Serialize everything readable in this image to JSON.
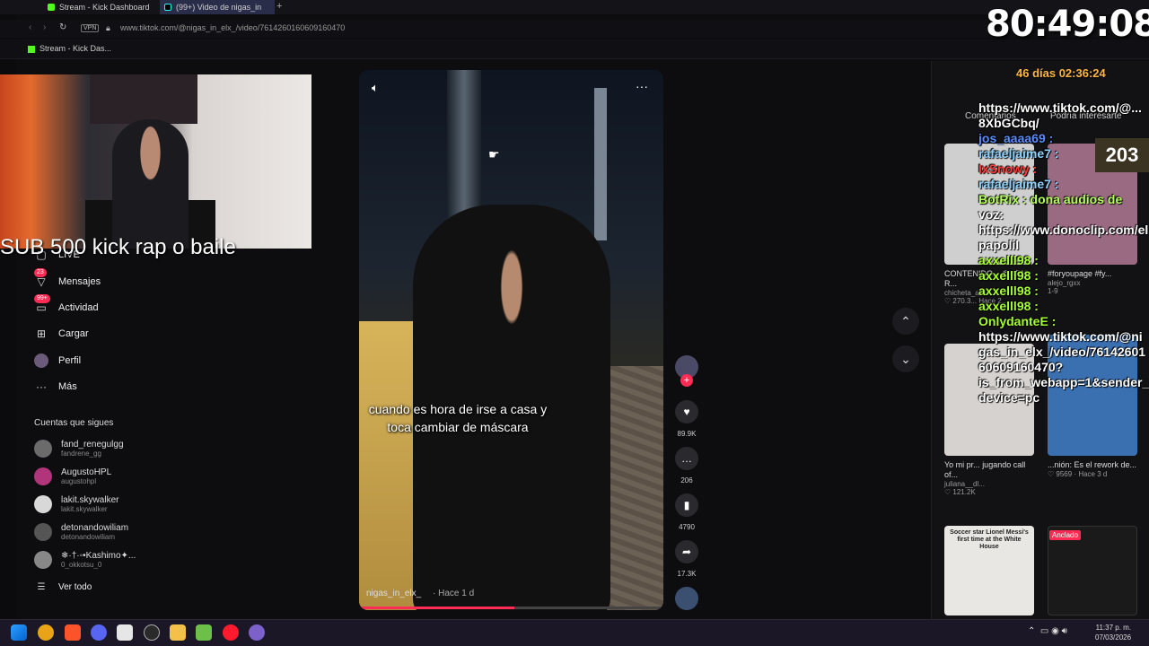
{
  "browser": {
    "tabs": [
      {
        "label": "Stream - Kick Dashboard"
      },
      {
        "label": "(99+) Video de nigas_in"
      }
    ],
    "url": "www.tiktok.com/@nigas_in_elx_/video/7614260160609160470",
    "vpn_label": "VPN",
    "bookmark": "Stream - Kick Das..."
  },
  "stream_overlay": {
    "text": "SUB 500 kick  rap o  baile",
    "timer": "80:49:08",
    "subtimer": "46 días 02:36:24",
    "viewers": "203"
  },
  "nav": {
    "items": [
      {
        "label": "LIVE",
        "icon": "live-icon"
      },
      {
        "label": "Mensajes",
        "icon": "message-icon",
        "badge": "23"
      },
      {
        "label": "Actividad",
        "icon": "inbox-icon",
        "badge": "99+"
      },
      {
        "label": "Cargar",
        "icon": "upload-icon"
      },
      {
        "label": "Perfil",
        "icon": "avatar"
      },
      {
        "label": "Más",
        "icon": "more-icon"
      }
    ],
    "following_title": "Cuentas que sigues",
    "following": [
      {
        "name": "fand_renegulgg",
        "handle": "fandrene_gg",
        "color": "#6b6b6b"
      },
      {
        "name": "AugustoHPL",
        "handle": "augustohpl",
        "color": "#b0357a"
      },
      {
        "name": "lakit.skywalker",
        "handle": "lakit.skywalker",
        "color": "#d8d8d8"
      },
      {
        "name": "detonandowiliam",
        "handle": "detonandowiliam",
        "color": "#555"
      },
      {
        "name": "❄·†·◦•Kashimo✦...",
        "handle": "0_okkotsu_0",
        "color": "#888"
      }
    ],
    "see_all": "Ver todo"
  },
  "video": {
    "caption": "cuando es hora de irse a casa y toca cambiar de máscara",
    "author": "nigas_in_elx_",
    "time": "· Hace 1 d",
    "progress_percent": 51,
    "likes": "89.9K",
    "comments": "206",
    "saves": "4790",
    "shares": "17.3K"
  },
  "right_panel": {
    "tabs": [
      "Comentarios",
      "Podría interesarte"
    ],
    "cards": [
      {
        "caption": "CONTENIDO... @KRIS R...",
        "author": "chicheta_a",
        "likes": "270.3...",
        "time": "Hace 2...",
        "color": "#cfcfcf"
      },
      {
        "caption": "#foryoupage #fy...",
        "author": "alejo_rgxx",
        "likes": "",
        "time": "1-9",
        "color": "#9a6a82"
      },
      {
        "caption": "Yo mi pr... jugando call of...",
        "author": "juliana__dl...",
        "likes": "121.2K",
        "time": "",
        "color": "#d6d2cf"
      },
      {
        "caption": "...nión: Es el rework de...",
        "author": "",
        "likes": "9569",
        "time": "Hace 3 d",
        "color": "#3a6fb0"
      },
      {
        "caption": "Soccer star Lionel Messi's first time at the White House",
        "author": "",
        "likes": "",
        "time": "",
        "color": "#e9e7e4"
      },
      {
        "caption": "Anclado",
        "author": "",
        "likes": "",
        "time": "",
        "color": "#1a1a1a"
      }
    ]
  },
  "chat": [
    {
      "text": "https://www.tiktok.com/@...",
      "cls": ""
    },
    {
      "text": "8XbGCbq/",
      "cls": ""
    },
    {
      "text": "jos_aaaa69 :",
      "cls": "u-blue"
    },
    {
      "text": "rafaeljaime7 :",
      "cls": "u-cyan"
    },
    {
      "text": "IxSnowy :",
      "cls": "u-red"
    },
    {
      "text": "rafaeljaime7 :",
      "cls": "u-cyan"
    },
    {
      "text": "BotRix : dona audios de",
      "cls": "u-green"
    },
    {
      "text": "voz:",
      "cls": ""
    },
    {
      "text": "https://www.donoclip.com/el",
      "cls": ""
    },
    {
      "text": "papolil",
      "cls": ""
    },
    {
      "text": "axxelll98 :",
      "cls": "u-lime"
    },
    {
      "text": "axxelll98 :",
      "cls": "u-lime"
    },
    {
      "text": "axxelll98 :",
      "cls": "u-lime"
    },
    {
      "text": "axxelll98 :",
      "cls": "u-lime"
    },
    {
      "text": "OnlydanteE :",
      "cls": "u-lime"
    },
    {
      "text": "https://www.tiktok.com/@ni",
      "cls": ""
    },
    {
      "text": "gas_in_elx_/video/76142601",
      "cls": ""
    },
    {
      "text": "60609160470?",
      "cls": ""
    },
    {
      "text": "is_from_webapp=1&sender_",
      "cls": ""
    },
    {
      "text": "device=pc",
      "cls": ""
    }
  ],
  "taskbar": {
    "time": "11:37 p. m.",
    "date": "07/03/2026"
  }
}
